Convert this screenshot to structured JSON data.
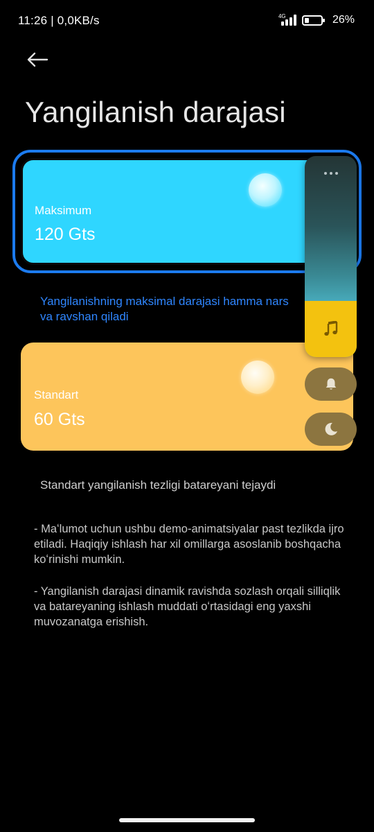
{
  "status_bar": {
    "time_speed": "11:26 | 0,0KB/s",
    "network": "4G",
    "battery_percent": "26%",
    "battery_level": 0.26
  },
  "header": {
    "title": "Yangilanish darajasi"
  },
  "options": [
    {
      "label": "Maksimum",
      "value": "120 Gts",
      "description": "Yangilanishning maksimal darajasi hamma narsani silliq va ravshan qiladi",
      "description_line1": "Yangilanishning maksimal darajasi hamma nars",
      "description_line2": "va ravshan qiladi",
      "selected": true,
      "color": "#2fd6ff"
    },
    {
      "label": "Standart",
      "value": "60 Gts",
      "description": "Standart yangilanish tezligi batareyani tejaydi",
      "selected": false,
      "color": "#fdc55b"
    }
  ],
  "notes": [
    "- Maʻlumot uchun ushbu demo-animatsiyalar past tezlikda ijro etiladi. Haqiqiy ishlash har xil omillarga asoslanib boshqacha koʻrinishi mumkin.",
    "- Yangilanish darajasi dinamik ravishda sozlash orqali silliqlik va batareyaning ishlash muddati oʻrtasidagi eng yaxshi muvozanatga erishish."
  ],
  "widget": {
    "icons": [
      "more-icon",
      "music-note-icon",
      "bell-icon",
      "moon-icon"
    ]
  },
  "colors": {
    "accent": "#1c7bef",
    "description_accent": "#2f86ff",
    "background": "#000000",
    "widget_music": "#f3c20f",
    "widget_button": "#8c7540"
  }
}
